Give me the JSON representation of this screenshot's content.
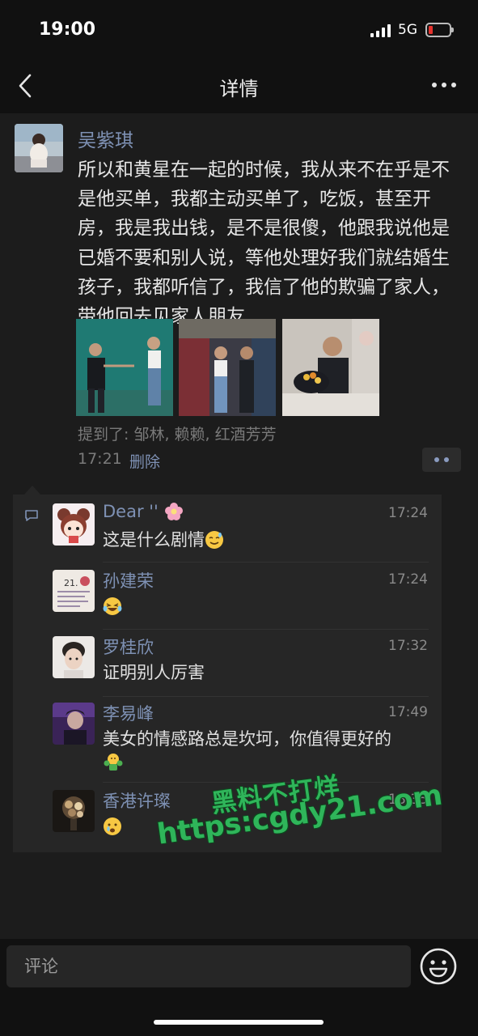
{
  "status": {
    "time": "19:00",
    "network": "5G"
  },
  "nav": {
    "title": "详情"
  },
  "post": {
    "author": "吴紫琪",
    "text": "所以和黄星在一起的时候，我从来不在乎是不是他买单，我都主动买单了，吃饭，甚至开房，我是我出钱，是不是很傻，他跟我说他是已婚不要和别人说，等他处理好我们就结婚生孩子，我都听信了，我信了他的欺骗了家人，带他回去见家人朋友",
    "mentions": "提到了: 邹林, 赖赖, 红酒芳芳",
    "time": "17:21",
    "delete_label": "删除"
  },
  "comments": [
    {
      "name": "Dear ''",
      "time": "17:24",
      "text": "这是什么剧情"
    },
    {
      "name": "孙建荣",
      "time": "17:24",
      "text": ""
    },
    {
      "name": "罗桂欣",
      "time": "17:32",
      "text": "证明别人厉害"
    },
    {
      "name": "李易峰",
      "time": "17:49",
      "text": "美女的情感路总是坎坷，你值得更好的"
    },
    {
      "name": "香港许璨",
      "time": "18:35",
      "text": ""
    }
  ],
  "watermark": {
    "line1": "黑料不打烊",
    "line2": "https:cgdy21.com"
  },
  "input": {
    "placeholder": "评论"
  },
  "colors": {
    "background": "#1c1c1c",
    "link": "#7e91b4",
    "panel": "#262626",
    "watermark": "#2fb55a"
  }
}
